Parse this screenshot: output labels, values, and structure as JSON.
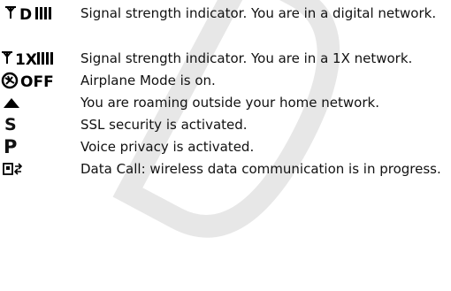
{
  "watermark": {
    "shape": "draft-watermark-outline"
  },
  "rows": [
    {
      "icon": "digital-signal-strength-icon",
      "icon_text": "D",
      "description": "Signal strength indicator. You are in a digital network."
    },
    {
      "icon": "1x-signal-strength-icon",
      "icon_text": "1X",
      "description": "Signal strength indicator. You are in a 1X network."
    },
    {
      "icon": "airplane-mode-icon",
      "icon_text": "OFF",
      "description": "Airplane Mode is on."
    },
    {
      "icon": "roaming-triangle-icon",
      "description": "You are roaming outside your home network."
    },
    {
      "icon": "ssl-security-icon",
      "icon_text": "S",
      "description": "SSL security is activated."
    },
    {
      "icon": "voice-privacy-icon",
      "icon_text": "P",
      "description": "Voice privacy is activated."
    },
    {
      "icon": "data-call-icon",
      "description": "Data Call: wireless data communication is in progress."
    }
  ],
  "colors": {
    "text": "#111111",
    "icon": "#000000",
    "watermark": "#000000"
  }
}
